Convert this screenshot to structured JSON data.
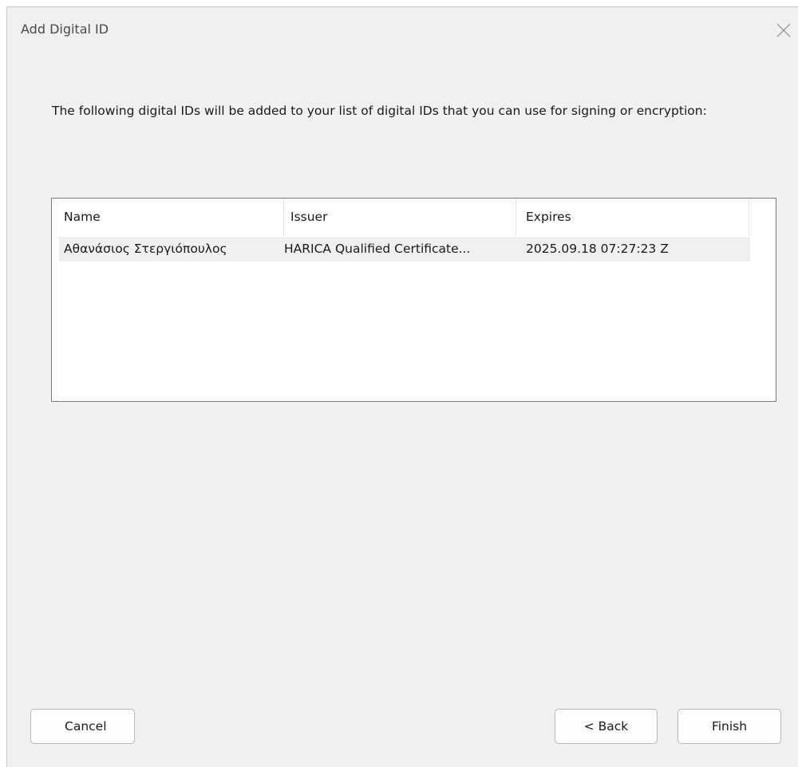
{
  "window": {
    "title": "Add Digital ID"
  },
  "intro_text": "The following digital IDs will be added to your list of digital IDs that you can use for signing or encryption:",
  "table": {
    "columns": [
      "Name",
      "Issuer",
      "Expires"
    ],
    "rows": [
      {
        "name": "Αθανάσιος Στεργιόπουλος",
        "issuer": "HARICA Qualified Certificate...",
        "expires": "2025.09.18 07:27:23 Z"
      }
    ]
  },
  "buttons": {
    "cancel": "Cancel",
    "back": "< Back",
    "finish": "Finish"
  },
  "icons": {
    "close": "close-icon"
  },
  "colors": {
    "dialog_background": "#f0f0f0",
    "list_background": "#ffffff",
    "selected_row": "#f0f0f0"
  }
}
